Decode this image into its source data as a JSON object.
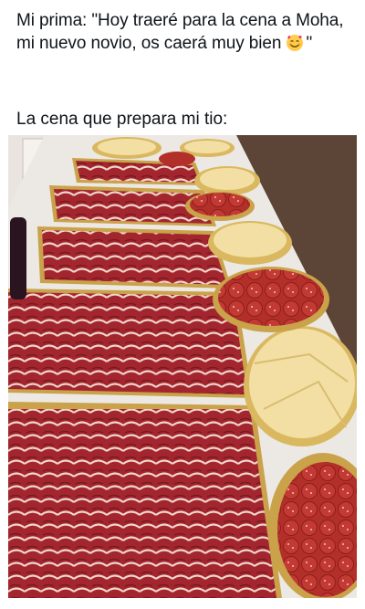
{
  "post": {
    "text_prefix": "Mi prima: \"Hoy traeré para la cena a Moha, mi nuevo novio, os caerá muy bien ",
    "emoji_name": "smiling-face-with-hearts-emoji",
    "text_suffix": "\"",
    "caption_2": "La cena que prepara mi tio:"
  },
  "photo": {
    "subject": "platters-of-sliced-ham-and-cheese-icon"
  },
  "colors": {
    "text": "#0f1419",
    "ham": "#a3262e",
    "fat": "#f1d7cf",
    "cheese": "#f3dfa3",
    "gold_tray": "#c9a24a",
    "table": "#ece8e3"
  }
}
